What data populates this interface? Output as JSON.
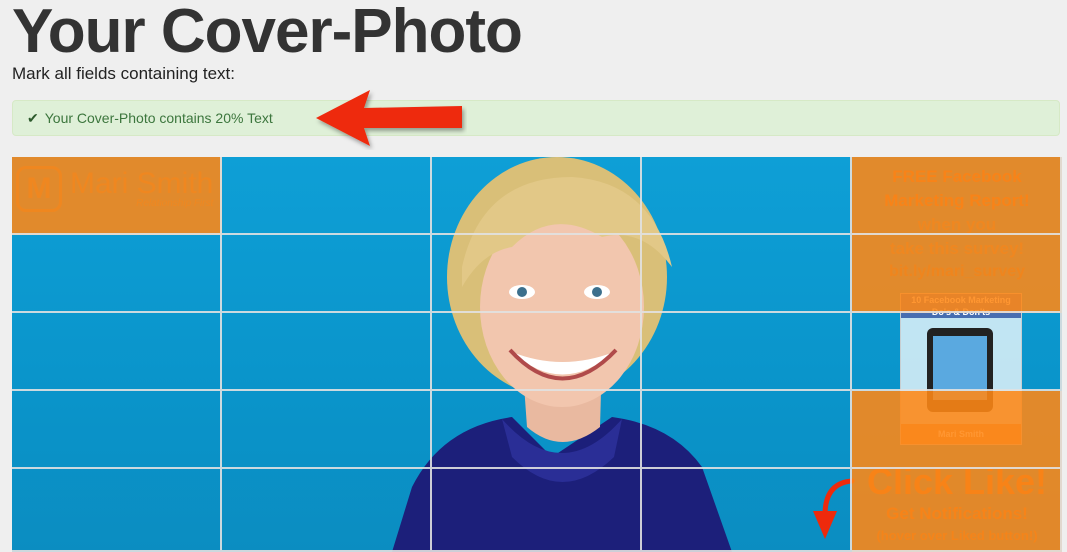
{
  "page": {
    "title": "Your Cover-Photo",
    "subtitle": "Mark all fields containing text:"
  },
  "alert": {
    "icon": "check-icon",
    "message": "Your Cover-Photo contains 20% Text"
  },
  "cover": {
    "logo": {
      "initial": "M",
      "name": "Mari Smith",
      "tagline": "Relationship First"
    },
    "promo": {
      "line1": "FREE Facebook",
      "line2": "Marketing Report!",
      "line3": "when you",
      "line4": "take this survey!",
      "url": "bit.ly/mari_survey",
      "book_title": "10 Facebook Marketing",
      "book_subtitle": "Do's & Don'ts",
      "book_author": "Mari Smith",
      "cta": "Click Like!",
      "cta_sub": "Get Notifications!",
      "cta_note": "(hover over Liked button!)"
    },
    "grid": {
      "rows": 5,
      "cols": 5,
      "marked": [
        [
          0,
          0
        ],
        [
          0,
          4
        ],
        [
          1,
          4
        ],
        [
          3,
          4
        ],
        [
          4,
          4
        ]
      ]
    }
  },
  "colors": {
    "marked_cell": "#ff8714",
    "alert_bg": "#dff0d8",
    "alert_text": "#3c763d",
    "arrow": "#ee2a0c"
  }
}
